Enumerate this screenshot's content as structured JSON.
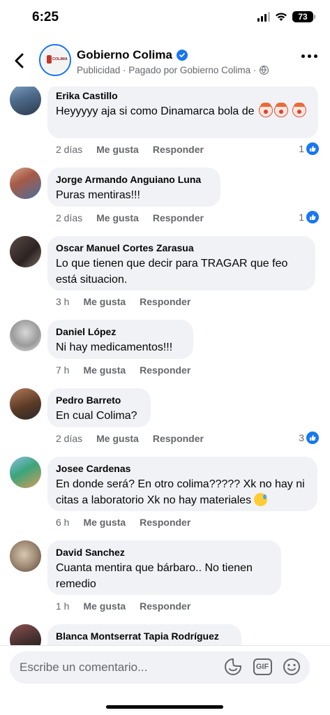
{
  "status_bar": {
    "time": "6:25",
    "battery": "73"
  },
  "header": {
    "page_name": "Gobierno Colima",
    "subtitle": "Publicidad · Pagado por Gobierno Colima ·",
    "avatar_text": "COLIMA"
  },
  "comments": [
    {
      "author": "Erika Castillo",
      "text": "Heyyyyy aja si como Dinamarca bola de",
      "time": "2 días",
      "like_label": "Me gusta",
      "reply_label": "Responder",
      "reactions": "1"
    },
    {
      "author": "Jorge Armando Anguiano Luna",
      "text": "Puras mentiras!!!",
      "time": "2 días",
      "like_label": "Me gusta",
      "reply_label": "Responder",
      "reactions": "1"
    },
    {
      "author": "Oscar Manuel Cortes Zarasua",
      "text": "Lo que tienen que decir para TRAGAR que feo está situacion.",
      "time": "3 h",
      "like_label": "Me gusta",
      "reply_label": "Responder",
      "reactions": ""
    },
    {
      "author": "Daniel López",
      "text": "Ni hay medicamentos!!!",
      "time": "7 h",
      "like_label": "Me gusta",
      "reply_label": "Responder",
      "reactions": ""
    },
    {
      "author": "Pedro Barreto",
      "text": "En cual Colima?",
      "time": "2 días",
      "like_label": "Me gusta",
      "reply_label": "Responder",
      "reactions": "3"
    },
    {
      "author": "Josee Cardenas",
      "text": "En donde será? En otro colima????? Xk no hay ni citas a laboratorio Xk no hay materiales",
      "time": "6 h",
      "like_label": "Me gusta",
      "reply_label": "Responder",
      "reactions": ""
    },
    {
      "author": "David Sanchez",
      "text": "Cuanta mentira que bárbaro.. No tienen remedio",
      "time": "1 h",
      "like_label": "Me gusta",
      "reply_label": "Responder",
      "reactions": ""
    },
    {
      "author": "Blanca Montserrat Tapia Rodríguez",
      "text": "",
      "time": "",
      "like_label": "",
      "reply_label": "",
      "reactions": ""
    }
  ],
  "composer": {
    "placeholder": "Escribe un comentario..."
  },
  "icons": {
    "back": "chevron-left-icon",
    "verified": "verified-badge-icon",
    "globe": "globe-icon",
    "more": "more-dots-icon",
    "like": "thumbs-up-icon",
    "sticker": "sticker-icon",
    "gif": "gif-icon",
    "emoji": "emoji-icon"
  },
  "colors": {
    "accent": "#1877f2",
    "bubble": "#f0f2f5",
    "meta": "#65676b"
  }
}
